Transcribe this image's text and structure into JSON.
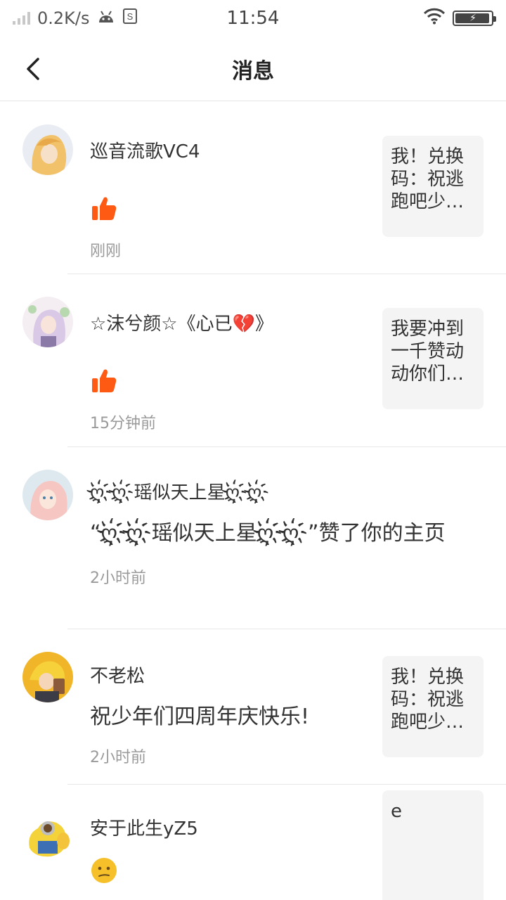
{
  "status_bar": {
    "speed": "0.2K/s",
    "time": "11:54"
  },
  "header": {
    "title": "消息"
  },
  "messages": [
    {
      "name": "巡音流歌VC4",
      "time": "刚刚",
      "ref_text": "我！兑换码：祝逃跑吧少…",
      "icon": "thumbs-up-icon"
    },
    {
      "name": "☆沫兮颜☆《心已💔》",
      "time": "15分钟前",
      "ref_text": "我要冲到一千赞动动你们…",
      "icon": "thumbs-up-icon"
    },
    {
      "name": "ღ҉ღ҉瑶似天上星ღ҉ღ҉",
      "text": "“ღ҉ღ҉瑶似天上星ღ҉ღ҉”赞了你的主页",
      "time": "2小时前"
    },
    {
      "name": "不老松",
      "text": "祝少年们四周年庆快乐!",
      "time": "2小时前",
      "ref_text": "我！兑换码：祝逃跑吧少…"
    },
    {
      "name": "安于此生yZ5",
      "ref_text": "e",
      "icon": "worried-face-icon"
    }
  ],
  "colors": {
    "accent": "#ff5a14",
    "divider": "#e8e8e8",
    "ref_bg": "#f4f4f4"
  }
}
